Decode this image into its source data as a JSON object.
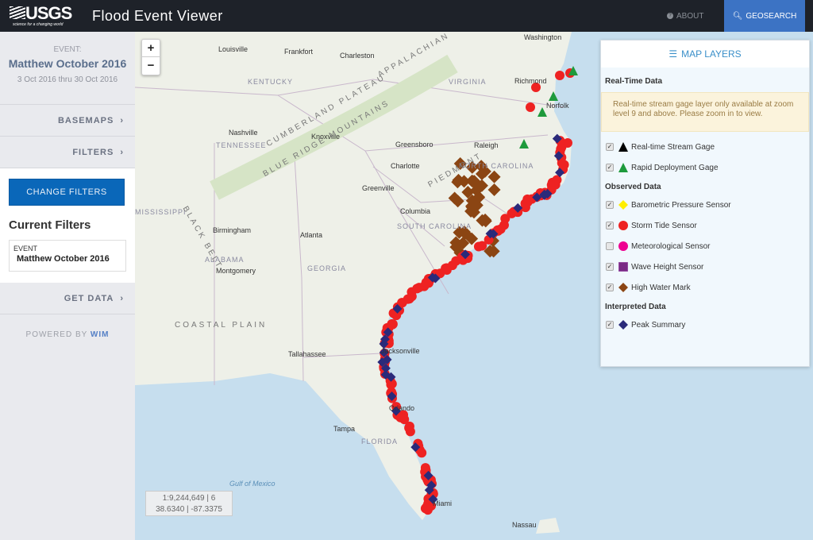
{
  "header": {
    "logo_text": "USGS",
    "logo_tagline": "science for a changing world",
    "title": "Flood Event Viewer",
    "about_label": "ABOUT",
    "geosearch_label": "GEOSEARCH",
    "about_icon": "question-circle-icon",
    "geosearch_icon": "search-icon"
  },
  "sidebar": {
    "event_label": "EVENT:",
    "event_name": "Matthew October 2016",
    "event_dates": "3 Oct 2016 thru 30 Oct 2016",
    "basemaps_label": "BASEMAPS",
    "filters_label": "FILTERS",
    "change_filters_label": "CHANGE FILTERS",
    "current_filters_title": "Current Filters",
    "filter_key": "EVENT",
    "filter_value": "Matthew October 2016",
    "get_data_label": "GET DATA",
    "powered_by": "POWERED BY",
    "powered_by_brand": "WIM"
  },
  "map": {
    "zoom_in": "+",
    "zoom_out": "−",
    "scale_readout": "1:9,244,649 | 6",
    "coords_readout": "38.6340 | -87.3375",
    "ocean_color": "#c6deee",
    "land_color": "#eef0e8",
    "labels": [
      "Washington",
      "Louisville",
      "Frankfort",
      "Charleston",
      "Richmond",
      "Norfolk",
      "KENTUCKY",
      "VIRGINIA",
      "Nashville",
      "Knoxville",
      "TENNESSEE",
      "Greensboro",
      "Raleigh",
      "Charlotte",
      "NORTH CAROLINA",
      "Greenville",
      "Columbia",
      "SOUTH CAROLINA",
      "MISSISSIPPI",
      "Birmingham",
      "Atlanta",
      "ALABAMA",
      "Montgomery",
      "GEORGIA",
      "Jacksonville",
      "Tallahassee",
      "Orlando",
      "Tampa",
      "FLORIDA",
      "Gulf of Mexico",
      "Miami",
      "Nassau",
      "APPALACHIAN",
      "BLUE RIDGE MOUNTAINS",
      "CUMBERLAND PLATEAU",
      "PIEDMONT",
      "COASTAL PLAIN",
      "BLACK BELT"
    ]
  },
  "layers": {
    "title": "MAP LAYERS",
    "title_icon": "list-icon",
    "realtime_title": "Real-Time Data",
    "warning": "Real-time stream gage layer only available at zoom level 9 and above. Please zoom in to view.",
    "realtime": [
      {
        "label": "Real-time Stream Gage",
        "checked": true,
        "symbol": "triangle",
        "color": "#000000"
      },
      {
        "label": "Rapid Deployment Gage",
        "checked": true,
        "symbol": "triangle",
        "color": "#1e9a3c"
      }
    ],
    "observed_title": "Observed Data",
    "observed": [
      {
        "label": "Barometric Pressure Sensor",
        "checked": true,
        "symbol": "diamond",
        "color": "#ffee00"
      },
      {
        "label": "Storm Tide Sensor",
        "checked": true,
        "symbol": "circle",
        "color": "#ee2222"
      },
      {
        "label": "Meteorological Sensor",
        "checked": false,
        "symbol": "circle",
        "color": "#ee0090"
      },
      {
        "label": "Wave Height Sensor",
        "checked": true,
        "symbol": "square",
        "color": "#7a2a85"
      },
      {
        "label": "High Water Mark",
        "checked": true,
        "symbol": "diamond",
        "color": "#8b4513"
      }
    ],
    "interpreted_title": "Interpreted Data",
    "interpreted": [
      {
        "label": "Peak Summary",
        "checked": true,
        "symbol": "diamond",
        "color": "#2a2a7a"
      }
    ]
  }
}
